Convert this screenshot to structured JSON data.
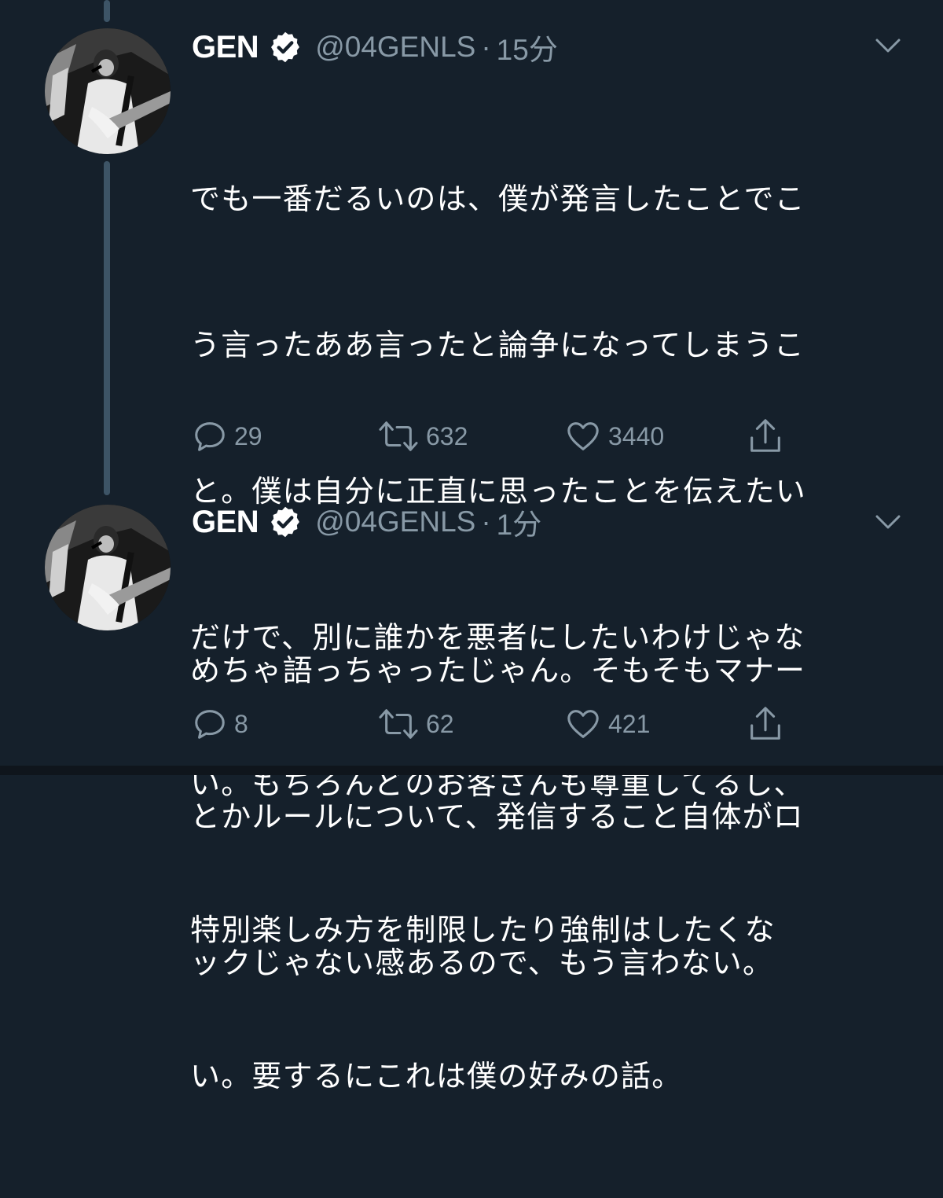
{
  "tweets": [
    {
      "name": "GEN",
      "handle": "@04GENLS",
      "separator": "·",
      "time": "15分",
      "lines": [
        "でも一番だるいのは、僕が発言したことでこ",
        "う言ったああ言ったと論争になってしまうこ",
        "と。僕は自分に正直に思ったことを伝えたい",
        "だけで、別に誰かを悪者にしたいわけじゃな",
        "い。もちろんどのお客さんも尊重してるし、",
        "特別楽しみ方を制限したり強制はしたくな",
        "い。要するにこれは僕の好みの話。"
      ],
      "replies": "29",
      "retweets": "632",
      "likes": "3440"
    },
    {
      "name": "GEN",
      "handle": "@04GENLS",
      "separator": "·",
      "time": "1分",
      "lines": [
        "めちゃ語っちゃったじゃん。そもそもマナー",
        "とかルールについて、発信すること自体がロ",
        "ックじゃない感あるので、もう言わない。"
      ],
      "replies": "8",
      "retweets": "62",
      "likes": "421"
    }
  ],
  "icons": {
    "verified": "verified-badge-icon",
    "caret": "chevron-down-icon",
    "reply": "reply-icon",
    "retweet": "retweet-icon",
    "like": "heart-icon",
    "share": "share-icon"
  },
  "colors": {
    "background": "#15202b",
    "secondary_text": "#8899a6",
    "thread_line": "#3d5466"
  }
}
